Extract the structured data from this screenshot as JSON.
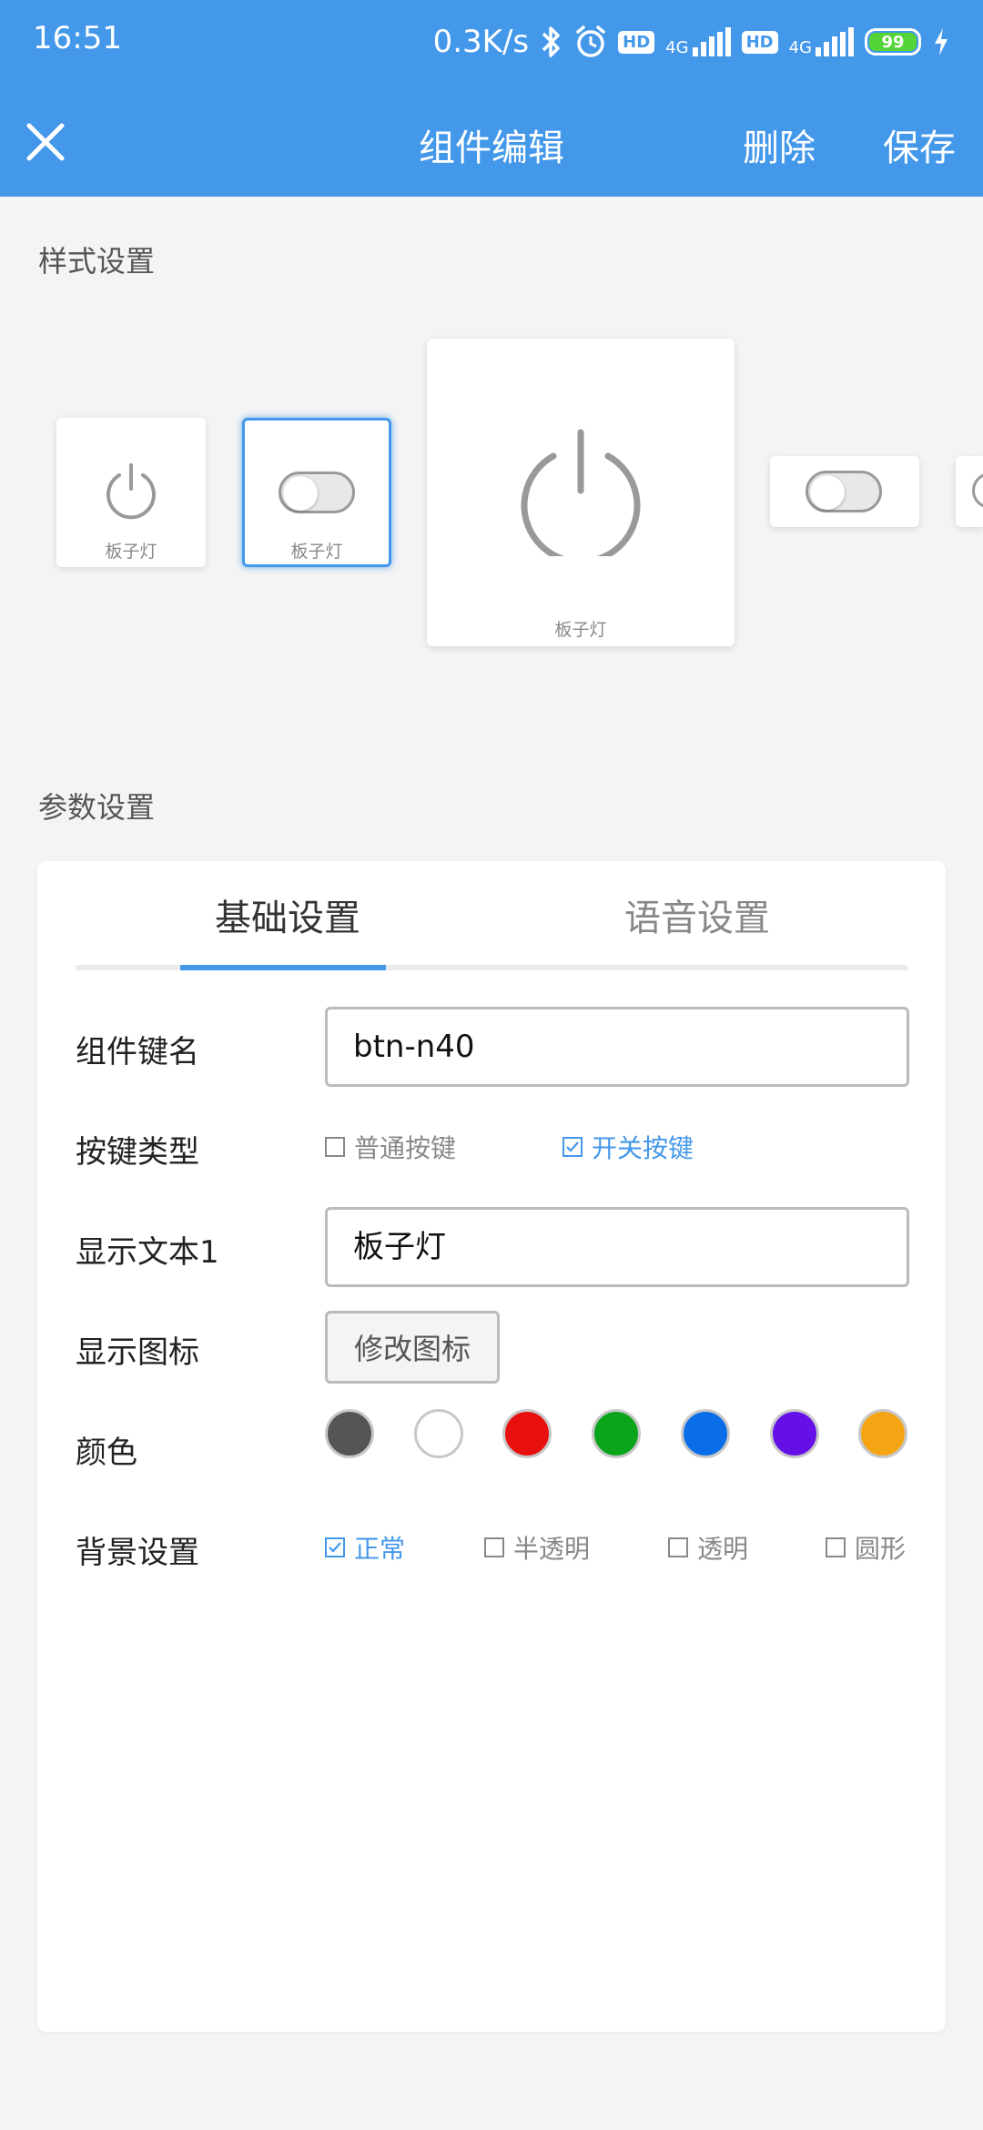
{
  "status_bar": {
    "time": "16:51",
    "speed": "0.3K/s",
    "hd1": "HD",
    "net1": "4G",
    "hd2": "HD",
    "net2": "4G",
    "battery": "99",
    "icons": [
      "bluetooth-icon",
      "alarm-icon",
      "signal-icon",
      "charging-icon"
    ]
  },
  "app_bar": {
    "title": "组件编辑",
    "delete_label": "删除",
    "save_label": "保存",
    "close_icon": "close-icon"
  },
  "style_section": {
    "title": "样式设置",
    "cards": [
      {
        "type": "power-small",
        "label": "板子灯"
      },
      {
        "type": "toggle-small",
        "label": "板子灯",
        "selected": true
      },
      {
        "type": "power-large",
        "label": "板子灯"
      },
      {
        "type": "toggle-wide"
      },
      {
        "type": "partial"
      }
    ]
  },
  "param_section": {
    "title": "参数设置",
    "tabs": [
      {
        "label": "基础设置",
        "active": true
      },
      {
        "label": "语音设置",
        "active": false
      }
    ],
    "fields": {
      "key_name": {
        "label": "组件键名",
        "value": "btn-n40"
      },
      "key_type": {
        "label": "按键类型",
        "options": [
          {
            "label": "普通按键",
            "checked": false
          },
          {
            "label": "开关按键",
            "checked": true
          }
        ]
      },
      "display_text": {
        "label": "显示文本1",
        "value": "板子灯"
      },
      "display_icon": {
        "label": "显示图标",
        "button": "修改图标"
      },
      "color": {
        "label": "颜色",
        "swatches": [
          "#555555",
          "#ffffff",
          "#e80f0f",
          "#0aa51b",
          "#0a6ee8",
          "#6610e8",
          "#f5a514"
        ]
      },
      "background": {
        "label": "背景设置",
        "options": [
          {
            "label": "正常",
            "checked": true
          },
          {
            "label": "半透明",
            "checked": false
          },
          {
            "label": "透明",
            "checked": false
          },
          {
            "label": "圆形",
            "checked": false
          }
        ]
      }
    }
  },
  "colors": {
    "accent": "#4498ea",
    "background": "#f4f4f4"
  }
}
